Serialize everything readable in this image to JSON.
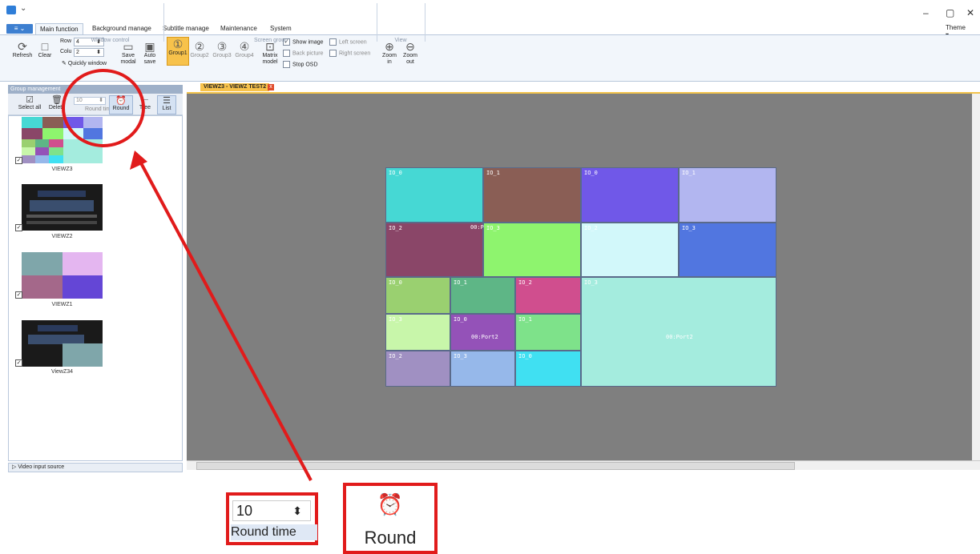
{
  "window": {
    "quick_access": "⌄",
    "min": "–",
    "restore": "▢",
    "close": "✕"
  },
  "tabs": {
    "file": "",
    "items": [
      "Main function",
      "Background manage",
      "Subtitle manage",
      "Maintenance",
      "System"
    ],
    "active": "Main function",
    "theme": "Theme"
  },
  "ribbon": {
    "refresh": "Refresh",
    "clear": "Clear",
    "row_label": "Row",
    "row_value": "4",
    "col_label": "Colu",
    "col_value": "2",
    "quickly_window": "Quickly window",
    "save_modal_1": "Save",
    "save_modal_2": "modal",
    "auto_save_1": "Auto",
    "auto_save_2": "save",
    "window_control": "Window control",
    "groups": [
      "Group1",
      "Group2",
      "Group3",
      "Group4"
    ],
    "matrix_model_1": "Matrix",
    "matrix_model_2": "model",
    "show_image": "Show image",
    "back_picture": "Back picture",
    "stop_osd": "Stop OSD",
    "left_screen": "Left screen",
    "right_screen": "Right screen",
    "screen_group": "Screen group",
    "zoom_in_1": "Zoom",
    "zoom_in_2": "in",
    "zoom_out_1": "Zoom",
    "zoom_out_2": "out",
    "view": "View"
  },
  "group_panel": {
    "title": "Group management",
    "select_all": "Select all",
    "delete": "Delete",
    "round_time_value": "10",
    "round_time": "Round time",
    "round": "Round",
    "tree": "Tree",
    "list": "List",
    "items": [
      "VIEWZ3",
      "VIEWZ2",
      "VIEWZ1",
      "ViewZ34"
    ],
    "video_input_source": "Video input source"
  },
  "doc_tab": {
    "title": "VIEWZ3 - VIEWZ TEST2",
    "close": "x"
  },
  "wall_cells": [
    {
      "label": "IO_0",
      "color": "#46d8d4"
    },
    {
      "label": "IO_1",
      "color": "#8a5e55"
    },
    {
      "label": "IO_0",
      "color": "#7058e8"
    },
    {
      "label": "IO_1",
      "color": "#b2b6f0"
    },
    {
      "label": "IO_2",
      "color": "#8a4668"
    },
    {
      "label": "IO_3",
      "color": "#8ef46e"
    },
    {
      "label": "IO_2",
      "color": "#d2f8fa"
    },
    {
      "label": "IO_3",
      "color": "#5176e0"
    },
    {
      "label": "IO_0",
      "color": "#9ad070"
    },
    {
      "label": "IO_1",
      "color": "#5eb686"
    },
    {
      "label": "IO_2",
      "color": "#d04e8e"
    },
    {
      "label": "IO_3",
      "color": "#a4ecde"
    },
    {
      "label": "IO_3",
      "color": "#c8f6aa"
    },
    {
      "label": "IO_0",
      "color": "#9452b8"
    },
    {
      "label": "IO_1",
      "color": "#7ee28a"
    },
    {
      "label": "IO_2",
      "color": "#a090c2"
    },
    {
      "label": "IO_3",
      "color": "#96b8ea"
    },
    {
      "label": "IO_0",
      "color": "#40e0f2"
    }
  ],
  "ports": {
    "p1": "00:P",
    "p2": "00:Port2",
    "p3": "00:Port2"
  },
  "zoom_callout": {
    "value": "10",
    "round_time": "Round time",
    "round": "Round"
  },
  "colors": {
    "accent": "#f7c24b",
    "callout_red": "#e11b1b",
    "ribbon_bg": "#f2f6fb",
    "canvas_bg": "#7f7f7f"
  }
}
